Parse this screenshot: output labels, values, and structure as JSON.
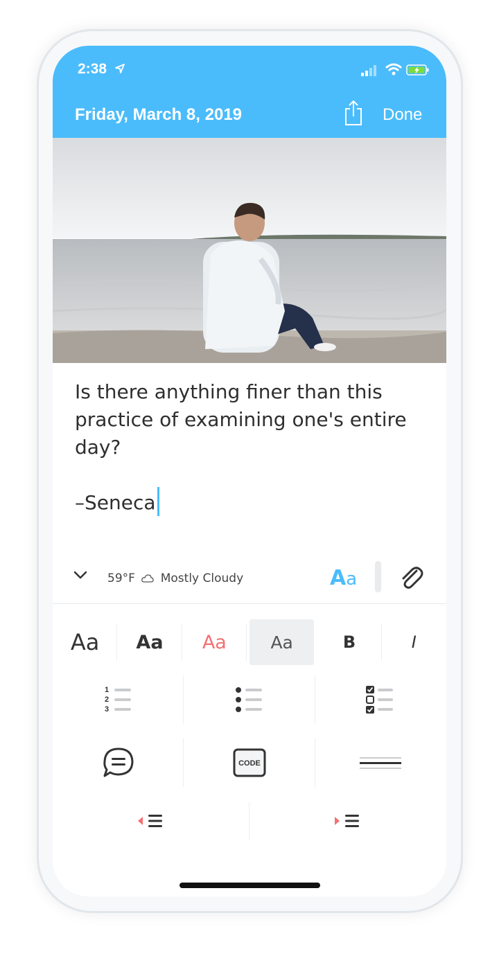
{
  "status_bar": {
    "time": "2:38"
  },
  "header": {
    "date": "Friday, March 8, 2019",
    "done_label": "Done"
  },
  "photo": {
    "description_icon": "photo"
  },
  "entry": {
    "lines": [
      "Is there anything finer than this",
      "practice of examining one's entire",
      "day?"
    ],
    "signature": "–Seneca"
  },
  "meta": {
    "temperature": "59°F",
    "weather": "Mostly Cloudy",
    "font_button": "A",
    "font_button_small": "a"
  },
  "format_bar": {
    "styles": [
      "Aa",
      "Aa",
      "Aa",
      "Aa"
    ],
    "bold": "B",
    "italic": "I",
    "code_label": "CODE",
    "numbered": [
      "1",
      "2",
      "3"
    ]
  },
  "colors": {
    "accent": "#4bbcfb",
    "red": "#f56f72"
  }
}
